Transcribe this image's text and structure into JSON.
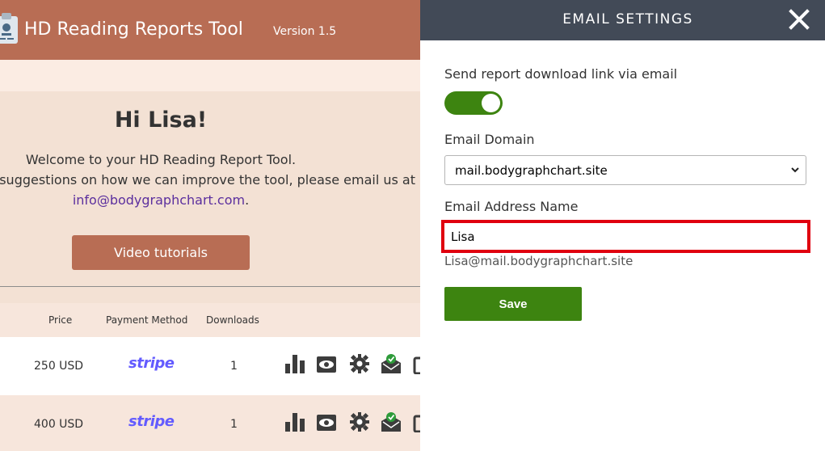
{
  "app": {
    "title": "HD Reading Reports Tool",
    "version": "Version 1.5",
    "greeting": "Hi Lisa!",
    "welcome": "Welcome to your HD Reading Report Tool.",
    "suggest": "y suggestions on how we can improve the tool, please email us at",
    "contact_email": "info@bodygraphchart.com",
    "contact_suffix": ".",
    "video_button": "Video tutorials"
  },
  "table": {
    "headers": [
      "Price",
      "Payment Method",
      "Downloads"
    ],
    "rows": [
      {
        "price": "250 USD",
        "payment": "stripe",
        "downloads": "1"
      },
      {
        "price": "400 USD",
        "payment": "stripe",
        "downloads": "1"
      }
    ],
    "action_icons": [
      "bar-chart-icon",
      "view-icon",
      "settings-icon",
      "email-sent-icon",
      "copy-icon"
    ]
  },
  "panel": {
    "title": "EMAIL SETTINGS",
    "toggle_label": "Send report download link via email",
    "toggle_on": true,
    "domain_label": "Email Domain",
    "domain_value": "mail.bodygraphchart.site",
    "name_label": "Email Address Name",
    "name_value": "Lisa",
    "address_preview": "Lisa@mail.bodygraphchart.site",
    "save_label": "Save"
  },
  "colors": {
    "brand": "#b86d54",
    "panel_header": "#424a57",
    "accent_green": "#3d8410",
    "highlight_red": "#e0000f",
    "stripe": "#635bff"
  }
}
